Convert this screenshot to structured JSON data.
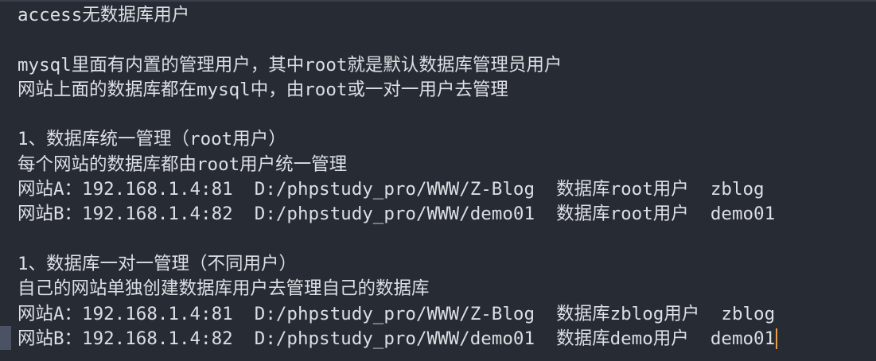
{
  "lines": [
    "access无数据库用户",
    "",
    "mysql里面有内置的管理用户，其中root就是默认数据库管理员用户",
    "网站上面的数据库都在mysql中，由root或一对一用户去管理",
    "",
    "1、数据库统一管理（root用户）",
    "每个网站的数据库都由root用户统一管理",
    "网站A：192.168.1.4:81  D:/phpstudy_pro/WWW/Z-Blog  数据库root用户  zblog",
    "网站B：192.168.1.4:82  D:/phpstudy_pro/WWW/demo01  数据库root用户  demo01",
    "",
    "1、数据库一对一管理（不同用户）",
    "自己的网站单独创建数据库用户去管理自己的数据库",
    "网站A：192.168.1.4:81  D:/phpstudy_pro/WWW/Z-Blog  数据库zblog用户  zblog",
    "网站B：192.168.1.4:82  D:/phpstudy_pro/WWW/demo01  数据库demo用户  demo01"
  ],
  "colors": {
    "background": "#272b33",
    "text": "#dcdfe4",
    "cursor": "#e5a04f"
  }
}
